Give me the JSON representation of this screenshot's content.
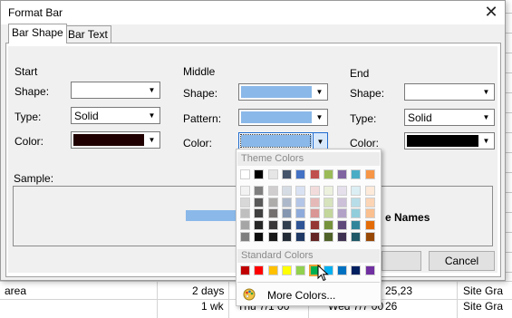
{
  "dialog": {
    "title": "Format Bar",
    "close_glyph": "✕",
    "tabs": [
      {
        "label": "Bar Shape",
        "active": true
      },
      {
        "label": "Bar Text",
        "active": false
      }
    ]
  },
  "start": {
    "heading": "Start",
    "shape_label": "Shape:",
    "shape_value": "",
    "type_label": "Type:",
    "type_value": "Solid",
    "color_label": "Color:",
    "color_value": "#200000"
  },
  "middle": {
    "heading": "Middle",
    "shape_label": "Shape:",
    "shape_fill": "#8ab8e9",
    "pattern_label": "Pattern:",
    "pattern_fill": "#8ab8e9",
    "color_label": "Color:",
    "color_value": "#8ab8e9"
  },
  "end": {
    "heading": "End",
    "shape_label": "Shape:",
    "shape_value": "",
    "type_label": "Type:",
    "type_value": "Solid",
    "color_label": "Color:",
    "color_value": "#000000"
  },
  "sample": {
    "label": "Sample:",
    "bar_color": "#8ab8e9",
    "text_fragment": "e Names"
  },
  "buttons": {
    "ok": "",
    "cancel": "Cancel"
  },
  "color_popup": {
    "theme_heading": "Theme Colors",
    "standard_heading": "Standard Colors",
    "more_colors": "More Colors...",
    "theme_top_row": [
      "#ffffff",
      "#000000",
      "#e7e6e6",
      "#44546a",
      "#4472c4",
      "#c0504d",
      "#9bbb59",
      "#8064a2",
      "#4bacc6",
      "#f79646"
    ],
    "theme_shades": [
      [
        "#f2f2f2",
        "#7f7f7f",
        "#d0cece",
        "#d6dce4",
        "#d9e2f3",
        "#f2dcdb",
        "#ebf1dd",
        "#e5e0ec",
        "#dbeef3",
        "#fdeada"
      ],
      [
        "#d8d8d8",
        "#595959",
        "#aeabab",
        "#adb9ca",
        "#b4c6e7",
        "#e5b9b7",
        "#d7e3bc",
        "#ccc1d9",
        "#b7dde8",
        "#fbd5b5"
      ],
      [
        "#bfbfbf",
        "#3f3f3f",
        "#757070",
        "#8496b0",
        "#8eaadb",
        "#d99694",
        "#c3d69b",
        "#b2a2c7",
        "#92cddc",
        "#fac08f"
      ],
      [
        "#a5a5a5",
        "#262626",
        "#3a3838",
        "#323f4f",
        "#2f5496",
        "#953734",
        "#76923c",
        "#5f497a",
        "#31859b",
        "#e36c09"
      ],
      [
        "#7f7f7f",
        "#0c0c0c",
        "#171616",
        "#222a35",
        "#1f3864",
        "#632423",
        "#4f6128",
        "#3f3151",
        "#205867",
        "#974806"
      ]
    ],
    "standard_colors": [
      "#c00000",
      "#ff0000",
      "#ffc000",
      "#ffff00",
      "#92d050",
      "#00b050",
      "#00b0f0",
      "#0070c0",
      "#002060",
      "#7030a0"
    ],
    "selected_standard_index": 5
  },
  "background": {
    "row1": {
      "name": "area",
      "duration": "2 days",
      "date": "25,23",
      "resource": "Site Gra"
    },
    "row2": {
      "duration": "1 wk",
      "start": "Thu 7/1 00",
      "finish": "Wed 7/7 00",
      "date": "26",
      "resource": "Site Gra"
    }
  }
}
